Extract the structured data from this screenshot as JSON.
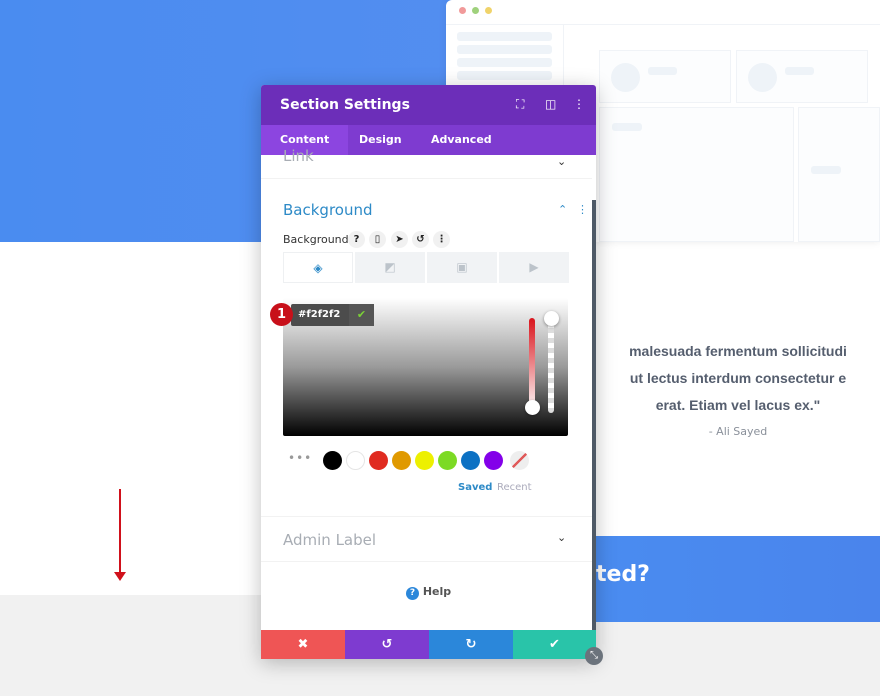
{
  "modal": {
    "title": "Section Settings",
    "icons": [
      "focus-icon",
      "split-view-icon",
      "more-vertical-icon"
    ],
    "tabs": [
      {
        "label": "Content",
        "active": true
      },
      {
        "label": "Design"
      },
      {
        "label": "Advanced"
      }
    ],
    "sections": {
      "link": "Link",
      "background": "Background",
      "admin_label": "Admin Label"
    },
    "background_field": {
      "label": "Background",
      "tools": [
        "help-icon",
        "mobile-icon",
        "hover-pointer-icon",
        "reset-icon",
        "more-icon"
      ],
      "type_tabs": [
        "color-icon",
        "gradient-icon",
        "image-icon",
        "video-icon"
      ],
      "hex_value": "#f2f2f2",
      "step_badge": "1",
      "swatches": [
        "#000000",
        "#ffffff",
        "#e02b20",
        "#e09900",
        "#edf000",
        "#7cda24",
        "#0c71c3",
        "#8300e9"
      ],
      "saved_label": "Saved",
      "recent_label": "Recent"
    },
    "help_label": "Help",
    "footer": [
      "close-icon",
      "undo-icon",
      "redo-icon",
      "save-check-icon"
    ]
  },
  "page": {
    "quote_lines": [
      "malesuada fermentum sollicitudi",
      "ut lectus interdum consectetur e",
      "erat. Etiam vel lacus ex.\""
    ],
    "author": "- Ali Sayed",
    "cta_text": "ted?"
  },
  "colors": {
    "header": "#6c2eb9",
    "tabs": "#7e3bd0",
    "accent": "#2d8ac7",
    "cancel": "#ef5555",
    "undo": "#7e3bd0",
    "redo": "#2b87da",
    "save": "#29c4a9"
  }
}
